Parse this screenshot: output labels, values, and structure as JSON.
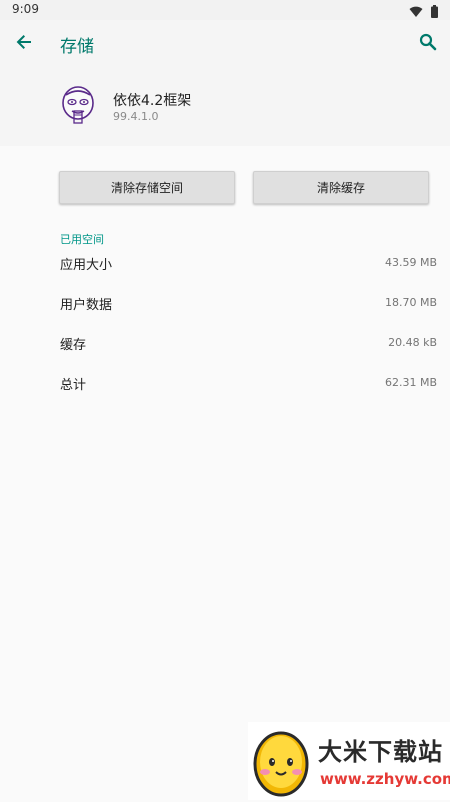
{
  "status_bar": {
    "time": "9:09",
    "icons": [
      "wifi-icon",
      "battery-icon"
    ]
  },
  "app_bar": {
    "title": "存储",
    "back_icon": "arrow-back-icon",
    "search_icon": "search-icon",
    "accent_color": "#00796b"
  },
  "app_info": {
    "name": "依依4.2框架",
    "version": "99.4.1.0"
  },
  "buttons": {
    "clear_storage": "清除存储空间",
    "clear_cache": "清除缓存"
  },
  "storage": {
    "section_title": "已用空间",
    "rows": [
      {
        "label": "应用大小",
        "value": "43.59 MB"
      },
      {
        "label": "用户数据",
        "value": "18.70 MB"
      },
      {
        "label": "缓存",
        "value": "20.48 kB"
      },
      {
        "label": "总计",
        "value": "62.31 MB"
      }
    ]
  },
  "watermark": {
    "name": "大米下载站",
    "url": "www.zzhyw.com"
  }
}
